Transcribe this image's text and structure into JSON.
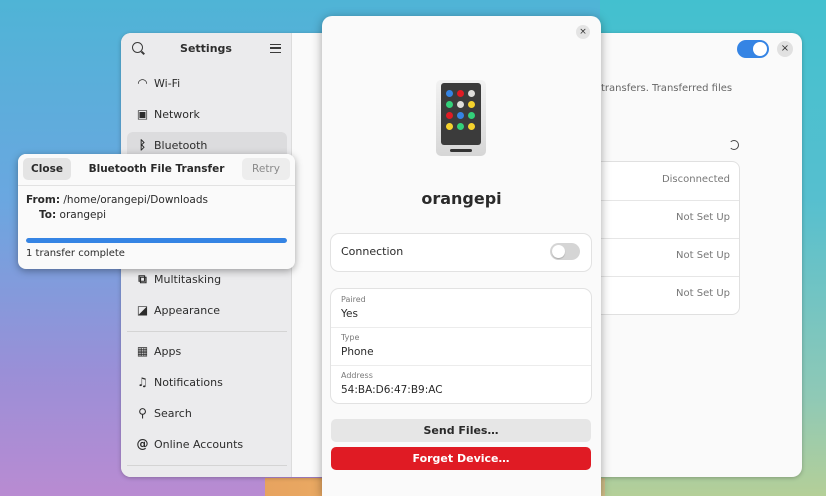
{
  "settings": {
    "title": "Settings",
    "sidebar": [
      {
        "label": "Wi-Fi",
        "icon": "wifi-icon"
      },
      {
        "label": "Network",
        "icon": "network-icon"
      },
      {
        "label": "Bluetooth",
        "icon": "bluetooth-icon"
      },
      {
        "label": "Multitasking",
        "icon": "multitasking-icon"
      },
      {
        "label": "Appearance",
        "icon": "appearance-icon"
      },
      {
        "label": "Apps",
        "icon": "apps-icon"
      },
      {
        "label": "Notifications",
        "icon": "bell-icon"
      },
      {
        "label": "Search",
        "icon": "search-icon"
      },
      {
        "label": "Online Accounts",
        "icon": "at-icon"
      }
    ],
    "content_text": "transfers. Transferred files",
    "device_statuses": [
      "Disconnected",
      "Not Set Up",
      "Not Set Up",
      "Not Set Up"
    ]
  },
  "device": {
    "name": "orangepi",
    "close_label": "×",
    "connection_label": "Connection",
    "connection_on": false,
    "info": [
      {
        "key": "Paired",
        "value": "Yes"
      },
      {
        "key": "Type",
        "value": "Phone"
      },
      {
        "key": "Address",
        "value": "54:BA:D6:47:B9:AC"
      }
    ],
    "send_label": "Send Files…",
    "forget_label": "Forget Device…"
  },
  "transfer": {
    "close_label": "Close",
    "title": "Bluetooth File Transfer",
    "retry_label": "Retry",
    "from_label": "From:",
    "from_value": "/home/orangepi/Downloads",
    "to_label": "To:",
    "to_value": "orangepi",
    "progress": 1.0,
    "status": "1 transfer complete"
  },
  "colors": {
    "accent": "#3584e4",
    "destructive": "#e01b24"
  }
}
